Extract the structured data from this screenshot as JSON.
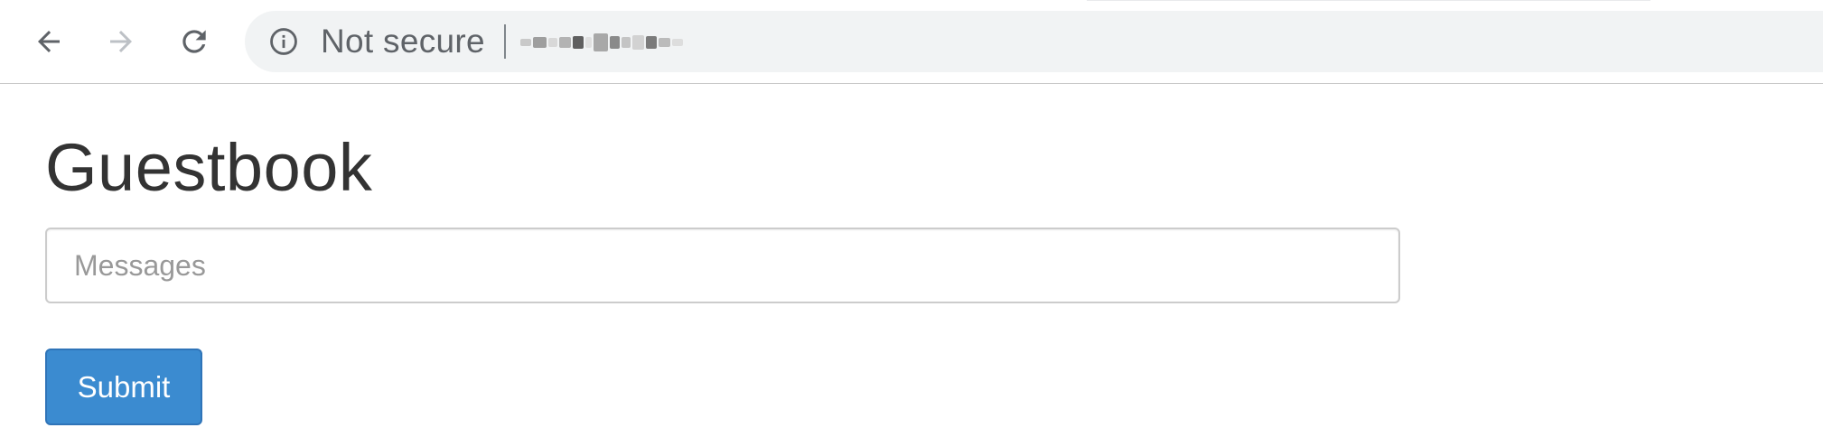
{
  "browser": {
    "back_icon": "arrow-left-icon",
    "forward_icon": "arrow-right-icon",
    "reload_icon": "reload-icon",
    "security_icon": "info-circle-icon",
    "security_text": "Not secure",
    "url_redacted": true,
    "colors": {
      "icon_active": "#5f6368",
      "icon_disabled": "#bdc1c6",
      "omnibox_bg": "#f1f3f4"
    }
  },
  "page": {
    "title": "Guestbook",
    "message_placeholder": "Messages",
    "message_value": "",
    "submit_label": "Submit"
  },
  "colors": {
    "primary_button": "#3b8bd0",
    "title_text": "#333333",
    "input_border": "#cccccc"
  }
}
